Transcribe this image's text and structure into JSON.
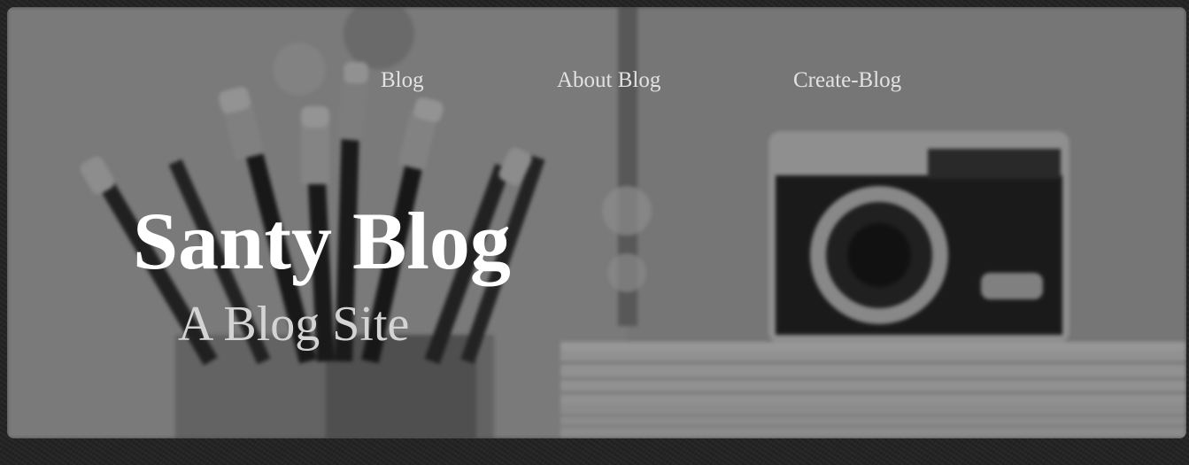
{
  "nav": {
    "items": [
      {
        "label": "Blog"
      },
      {
        "label": "About Blog"
      },
      {
        "label": "Create-Blog"
      }
    ]
  },
  "hero": {
    "title": "Santy Blog",
    "subtitle": "A Blog Site",
    "background_image": "blurred-desk-photo"
  },
  "colors": {
    "page_background": "#232323",
    "title": "#ffffff",
    "subtitle": "#d4d4d4",
    "nav_link": "#e2e2e2"
  }
}
